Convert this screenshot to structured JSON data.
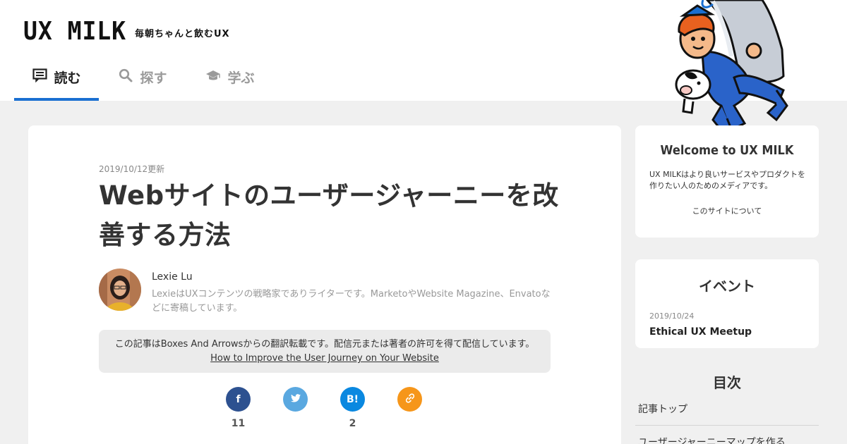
{
  "header": {
    "logo": "UX MILK",
    "tagline": "毎朝ちゃんと飲むUX",
    "nav": [
      {
        "label": "読む",
        "icon": "article-icon",
        "active": true
      },
      {
        "label": "探す",
        "icon": "search-icon",
        "active": false
      },
      {
        "label": "学ぶ",
        "icon": "graduation-cap-icon",
        "active": false
      }
    ],
    "accent_color": "#1a6fd1"
  },
  "article": {
    "date": "2019/10/12更新",
    "title": "Webサイトのユーザージャーニーを改善する方法",
    "author": {
      "name": "Lexie Lu",
      "bio": "LexieはUXコンテンツの戦略家でありライターです。MarketoやWebsite Magazine、Envatoなどに寄稿しています。"
    },
    "notice": {
      "text": "この記事はBoxes And Arrowsからの翻訳転載です。配信元または著者の許可を得て配信しています。",
      "link": "How to Improve the User Journey on Your Website"
    },
    "shares": [
      {
        "name": "facebook",
        "icon": "facebook-icon",
        "glyph": "f",
        "color": "#2d5190",
        "count": "11"
      },
      {
        "name": "twitter",
        "icon": "twitter-icon",
        "glyph": "",
        "color": "#5aa8e0",
        "count": ""
      },
      {
        "name": "hatena",
        "icon": "hatena-bookmark-icon",
        "glyph": "B!",
        "color": "#0a88e0",
        "count": "2"
      },
      {
        "name": "link",
        "icon": "link-icon",
        "glyph": "",
        "color": "#f6961a",
        "count": ""
      }
    ]
  },
  "sidebar": {
    "welcome": {
      "title": "Welcome to UX MILK",
      "text": "UX MILKはより良いサービスやプロダクトを作りたい人のためのメディアです。",
      "link": "このサイトについて"
    },
    "events": {
      "title": "イベント",
      "date": "2019/10/24",
      "name": "Ethical UX Meetup"
    },
    "toc": {
      "title": "目次",
      "items": [
        "記事トップ",
        "ユーザージャーニーマップを作る"
      ]
    }
  }
}
